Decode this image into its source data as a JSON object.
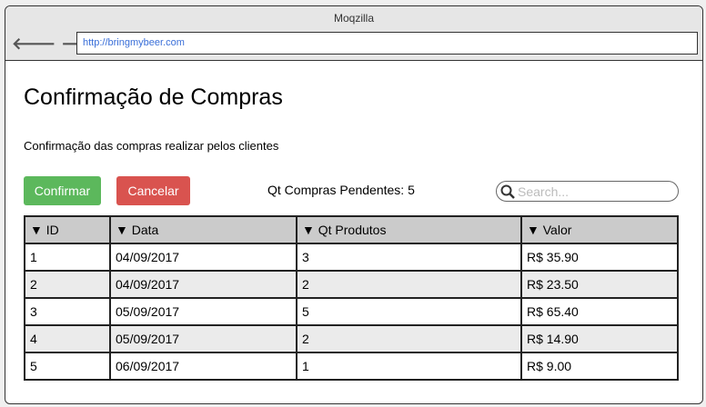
{
  "window": {
    "title": "Moqzilla",
    "url": "http://bringmybeer.com"
  },
  "page": {
    "title": "Confirmação de Compras",
    "subtitle": "Confirmação das compras realizar pelos clientes",
    "confirm_label": "Confirmar",
    "cancel_label": "Cancelar",
    "pending": "Qt Compras Pendentes: 5",
    "search_placeholder": "Search..."
  },
  "table": {
    "headers": [
      "▼ ID",
      "▼ Data",
      "▼ Qt Produtos",
      "▼ Valor"
    ],
    "rows": [
      [
        "1",
        "04/09/2017",
        "3",
        "R$ 35.90"
      ],
      [
        "2",
        "04/09/2017",
        "2",
        "R$ 23.50"
      ],
      [
        "3",
        "05/09/2017",
        "5",
        "R$ 65.40"
      ],
      [
        "4",
        "05/09/2017",
        "2",
        "R$ 14.90"
      ],
      [
        "5",
        "06/09/2017",
        "1",
        "R$ 9.00"
      ]
    ]
  }
}
